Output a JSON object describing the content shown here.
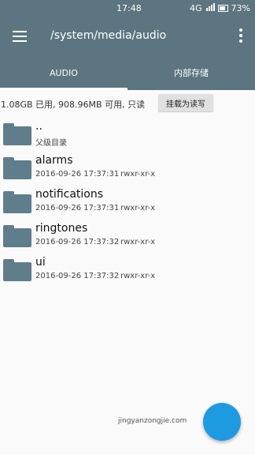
{
  "status": {
    "time": "17:48",
    "network": "4G",
    "battery": "73%"
  },
  "toolbar": {
    "path": "/system/media/audio"
  },
  "tabs": {
    "audio": "AUDIO",
    "storage": "内部存储"
  },
  "info": {
    "text": "1.08GB 已用, 908.96MB 可用, 只读",
    "mount_label": "挂载为读写"
  },
  "list": [
    {
      "name": "..",
      "sub": "父级目录"
    },
    {
      "name": "alarms",
      "date": "2016-09-26 17:37:31",
      "perm": "rwxr-xr-x"
    },
    {
      "name": "notifications",
      "date": "2016-09-26 17:37:31",
      "perm": "rwxr-xr-x"
    },
    {
      "name": "ringtones",
      "date": "2016-09-26 17:37:32",
      "perm": "rwxr-xr-x"
    },
    {
      "name": "ui",
      "date": "2016-09-26 17:37:32",
      "perm": "rwxr-xr-x"
    }
  ],
  "watermark": "jingyanzongjie.com"
}
